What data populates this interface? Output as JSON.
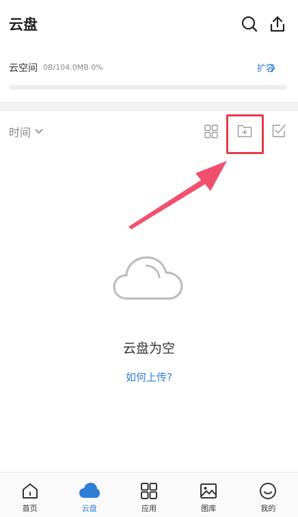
{
  "header": {
    "title": "云盘",
    "search_icon": "search-icon",
    "upload_icon": "upload-icon"
  },
  "space": {
    "label": "云空间",
    "usage": "0B/104.0MB 0%",
    "used_fraction": 0,
    "expand_label": "扩容"
  },
  "toolbar": {
    "sort_label": "时间",
    "icons": [
      "grid-view-icon",
      "new-folder-icon",
      "select-icon"
    ]
  },
  "empty_state": {
    "icon": "cloud-outline-icon",
    "title": "云盘为空",
    "upload_link": "如何上传?"
  },
  "tabbar": {
    "tabs": [
      {
        "label": "首页",
        "icon": "home-icon",
        "active": false
      },
      {
        "label": "云盘",
        "icon": "cloud-icon",
        "active": true
      },
      {
        "label": "应用",
        "icon": "apps-icon",
        "active": false
      },
      {
        "label": "图库",
        "icon": "gallery-icon",
        "active": false
      },
      {
        "label": "我的",
        "icon": "profile-icon",
        "active": false
      }
    ]
  },
  "colors": {
    "accent": "#2f7ed8",
    "highlight": "#e53945",
    "arrow": "#f0506e"
  }
}
